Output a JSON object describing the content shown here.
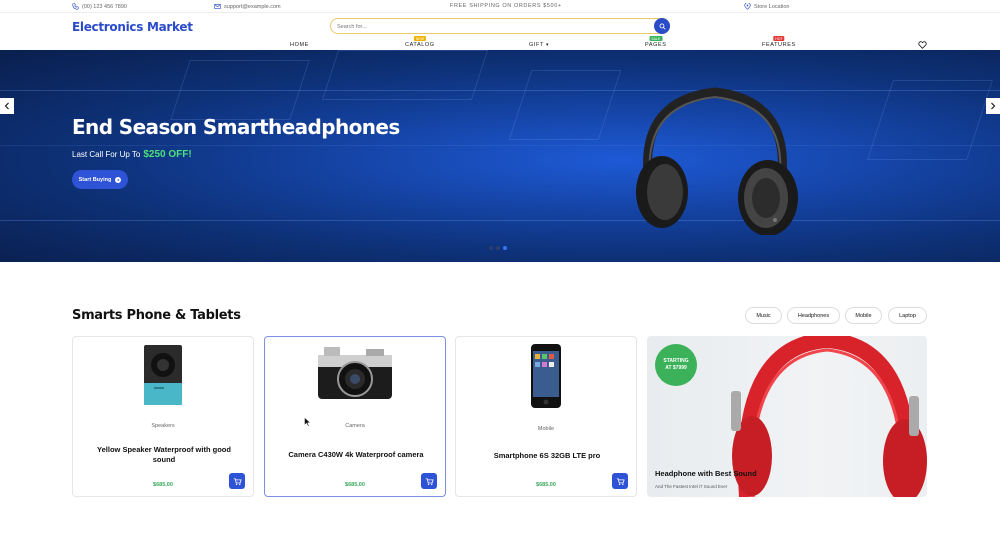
{
  "topbar": {
    "phone": "(00) 123 456 7890",
    "email": "support@example.com",
    "shipping": "FREE SHIPPING ON ORDERS $500+",
    "store": "Store Location"
  },
  "header": {
    "logo": "Electronics Market",
    "search_placeholder": "Search for..."
  },
  "nav": {
    "items": [
      {
        "label": "HOME"
      },
      {
        "label": "CATALOG",
        "badge": "NEW",
        "badge_color": "#f0b400"
      },
      {
        "label": "GIFT"
      },
      {
        "label": "PAGES",
        "badge": "SALE",
        "badge_color": "#3bb25a"
      },
      {
        "label": "FEATURES",
        "badge": "HOT",
        "badge_color": "#e23b3b"
      }
    ]
  },
  "hero": {
    "title": "End Season Smartheadphones",
    "subtitle_prefix": "Last Call For Up To",
    "subtitle_highlight": "$250 OFF!",
    "button": "Start Buying"
  },
  "section": {
    "title": "Smarts Phone & Tablets",
    "filters": [
      "Music",
      "Headphones",
      "Mobile",
      "Laptop"
    ]
  },
  "products": [
    {
      "category": "Speakers",
      "name": "Yellow Speaker Waterproof with good sound",
      "price": "$685.00"
    },
    {
      "category": "Camera",
      "name": "Camera C430W 4k Waterproof camera",
      "price": "$685.00"
    },
    {
      "category": "Mobile",
      "name": "Smartphone 6S 32GB LTE pro",
      "price": "$685.00"
    }
  ],
  "promo": {
    "badge_line1": "STARTING",
    "badge_line2": "AT $7999",
    "title": "Headphone with Best Sound",
    "subtitle": "And The Fastest Intel i7 Sound Ever"
  },
  "colors": {
    "brand": "#2b4bc9",
    "accent_green": "#3bb25a",
    "hero_highlight": "#4ee07a"
  }
}
